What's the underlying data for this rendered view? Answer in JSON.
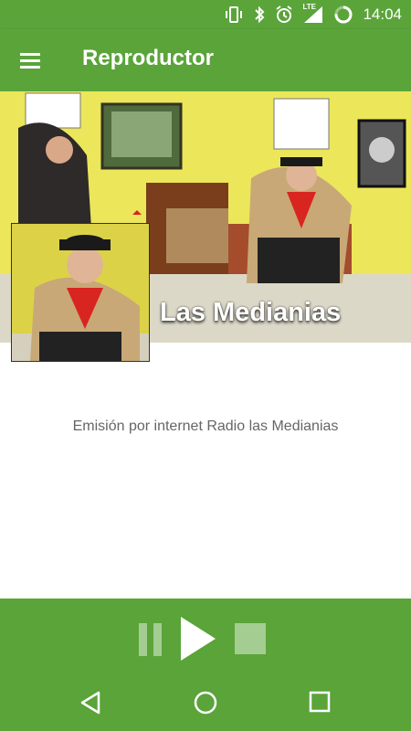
{
  "status_bar": {
    "time": "14:04",
    "network_label": "LTE",
    "icons": [
      "vibrate-icon",
      "bluetooth-icon",
      "alarm-icon",
      "signal-icon",
      "battery-icon"
    ]
  },
  "app_bar": {
    "title": "Reproductor",
    "menu_icon": "hamburger-menu-icon"
  },
  "header": {
    "station_name": "Las Medianias",
    "image": "radio-hosts-photo"
  },
  "main": {
    "description": "Emisión por internet Radio las Medianias"
  },
  "player": {
    "controls": [
      "pause-icon",
      "play-icon",
      "stop-icon"
    ]
  },
  "nav_bar": {
    "buttons": [
      "back-icon",
      "home-icon",
      "recent-apps-icon"
    ]
  },
  "colors": {
    "primary": "#5aa43a",
    "text_secondary": "#666666",
    "header_bg": "#ece65a"
  }
}
